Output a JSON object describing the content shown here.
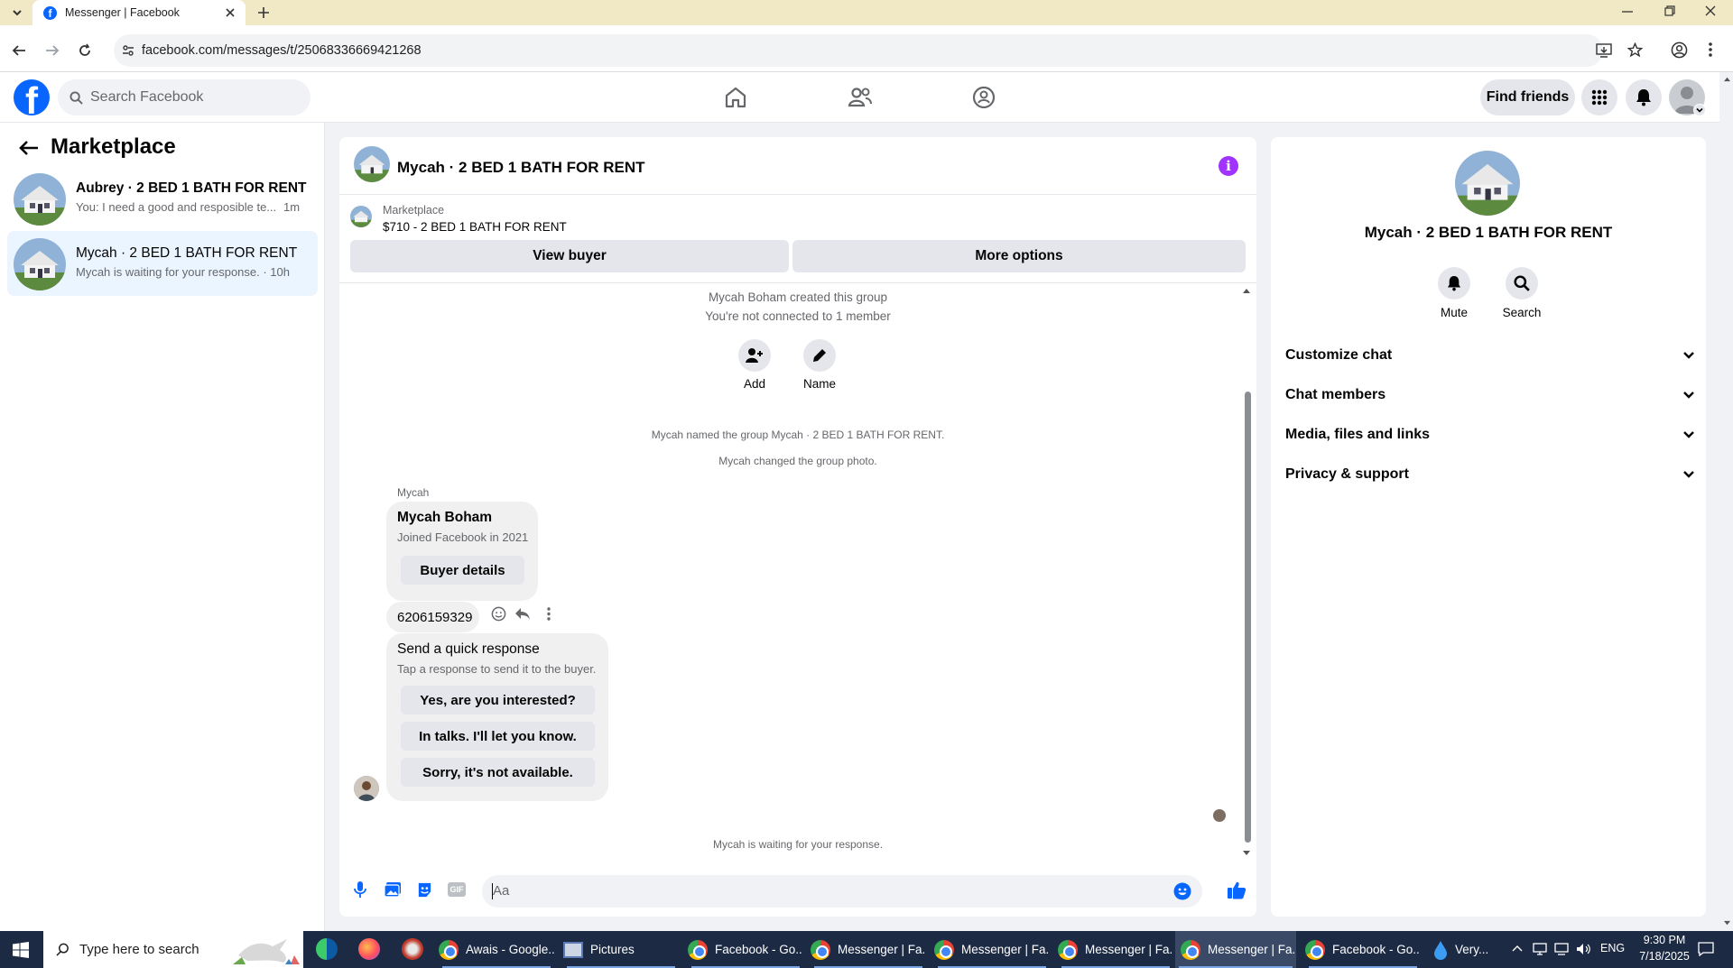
{
  "browser": {
    "tab_title": "Messenger | Facebook",
    "url": "facebook.com/messages/t/25068336669421268"
  },
  "header": {
    "search_placeholder": "Search Facebook",
    "find_friends": "Find friends"
  },
  "sidebar": {
    "title": "Marketplace",
    "conversations": [
      {
        "name": "Aubrey · 2 BED 1 BATH FOR RENT",
        "preview": "You: I need a good and resposible te...",
        "time": "1m"
      },
      {
        "name": "Mycah · 2 BED 1 BATH FOR RENT",
        "preview": "Mycah is waiting for your response. · 10h",
        "time": ""
      }
    ]
  },
  "chat": {
    "title": "Mycah · 2 BED 1 BATH FOR RENT",
    "listing_source": "Marketplace",
    "listing_title": "$710 - 2 BED 1 BATH FOR RENT",
    "view_buyer": "View buyer",
    "more_options": "More options",
    "system_created": "Mycah Boham created this group",
    "system_not_connected": "You're not connected to 1 member",
    "add_label": "Add",
    "name_label": "Name",
    "system_named": "Mycah named the group Mycah · 2 BED 1 BATH FOR RENT.",
    "system_photo": "Mycah changed the group photo.",
    "sender": "Mycah",
    "buyer_card": {
      "name": "Mycah Boham",
      "joined": "Joined Facebook in 2021",
      "button": "Buyer details"
    },
    "phone_message": "6206159329",
    "quick_response": {
      "title": "Send a quick response",
      "subtitle": "Tap a response to send it to the buyer.",
      "options": [
        "Yes, are you interested?",
        "In talks. I'll let you know.",
        "Sorry, it's not available."
      ]
    },
    "waiting": "Mycah is waiting for your response.",
    "composer_placeholder": "Aa"
  },
  "details": {
    "title": "Mycah · 2 BED 1 BATH FOR RENT",
    "mute": "Mute",
    "search": "Search",
    "sections": [
      "Customize chat",
      "Chat members",
      "Media, files and links",
      "Privacy & support"
    ]
  },
  "taskbar": {
    "search_placeholder": "Type here to search",
    "items": [
      "Awais - Google...",
      "Pictures",
      "Facebook - Go...",
      "Messenger | Fa...",
      "Messenger | Fa...",
      "Messenger | Fa...",
      "Messenger | Fa...",
      "Facebook - Go..."
    ],
    "weather": "Very...",
    "lang": "ENG",
    "time": "9:30 PM",
    "date": "7/18/2025"
  },
  "colors": {
    "fb_blue": "#0866ff",
    "accent_purple": "#a033ff",
    "taskbar": "#1c2a44"
  }
}
